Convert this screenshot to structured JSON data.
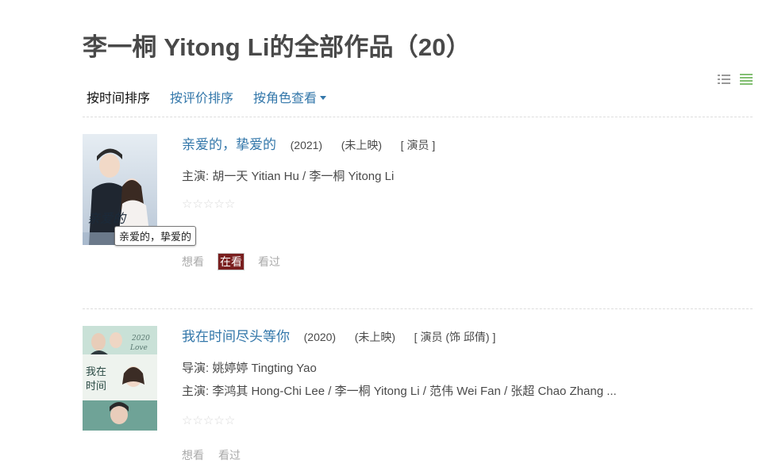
{
  "page": {
    "title": "李一桐 Yitong Li的全部作品（20）"
  },
  "view_toggle": {
    "list_icon": "list-view-icon",
    "grid_icon": "grid-view-icon",
    "accent": "#83bf73"
  },
  "sort_bar": {
    "by_time": "按时间排序",
    "by_rating": "按评价排序",
    "by_role": "按角色查看"
  },
  "items": [
    {
      "title": "亲爱的，挚爱的",
      "year": "(2021)",
      "status": "(未上映)",
      "role": "[ 演员 ]",
      "credits": [
        {
          "label": "主演: ",
          "value": "胡一天 Yitian Hu / 李一桐 Yitong Li"
        }
      ],
      "stars": [
        "☆",
        "☆",
        "☆",
        "☆",
        "☆"
      ],
      "actions": [
        "想看",
        "在看",
        "看过"
      ],
      "active_action": "在看",
      "tooltip": "亲爱的，挚爱的"
    },
    {
      "title": "我在时间尽头等你",
      "year": "(2020)",
      "status": "(未上映)",
      "role": "[ 演员 (饰 邱倩) ]",
      "credits": [
        {
          "label": "导演: ",
          "value": "姚婷婷 Tingting Yao"
        },
        {
          "label": "主演: ",
          "value": "李鸿其 Hong-Chi Lee / 李一桐 Yitong Li / 范伟 Wei Fan / 张超 Chao Zhang ..."
        }
      ],
      "stars": [
        "☆",
        "☆",
        "☆",
        "☆",
        "☆"
      ],
      "actions": [
        "想看",
        "看过"
      ]
    }
  ]
}
